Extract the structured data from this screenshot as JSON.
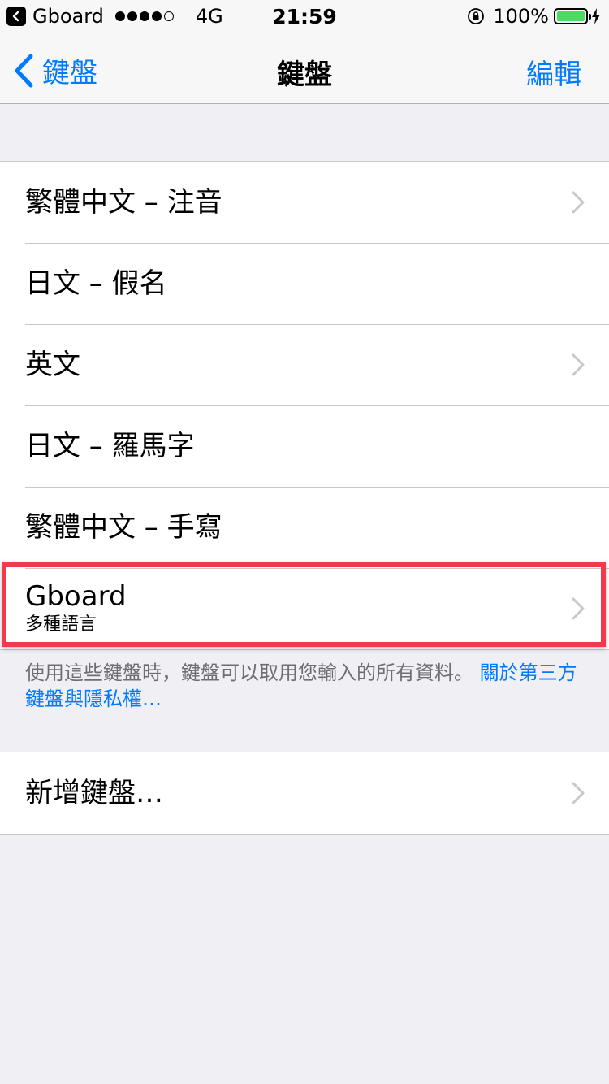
{
  "status_bar": {
    "back_app": "Gboard",
    "carrier": "4G",
    "time": "21:59",
    "battery_percent": "100%",
    "battery_level": 1.0,
    "battery_color": "#4cd964"
  },
  "nav": {
    "back_label": "鍵盤",
    "title": "鍵盤",
    "edit_label": "編輯"
  },
  "keyboards": [
    {
      "title": "繁體中文 – 注音",
      "has_chevron": true
    },
    {
      "title": "日文 – 假名",
      "has_chevron": false
    },
    {
      "title": "英文",
      "has_chevron": true
    },
    {
      "title": "日文 – 羅馬字",
      "has_chevron": false
    },
    {
      "title": "繁體中文 – 手寫",
      "has_chevron": false
    },
    {
      "title": "Gboard",
      "subtitle": "多種語言",
      "has_chevron": true,
      "highlighted": true
    }
  ],
  "footer": {
    "text": "使用這些鍵盤時，鍵盤可以取用您輸入的所有資料。",
    "link": "關於第三方鍵盤與隱私權…"
  },
  "add_keyboard": {
    "label": "新增鍵盤…"
  },
  "colors": {
    "accent": "#007aff",
    "highlight": "#f23a4b",
    "background": "#efeff4"
  }
}
